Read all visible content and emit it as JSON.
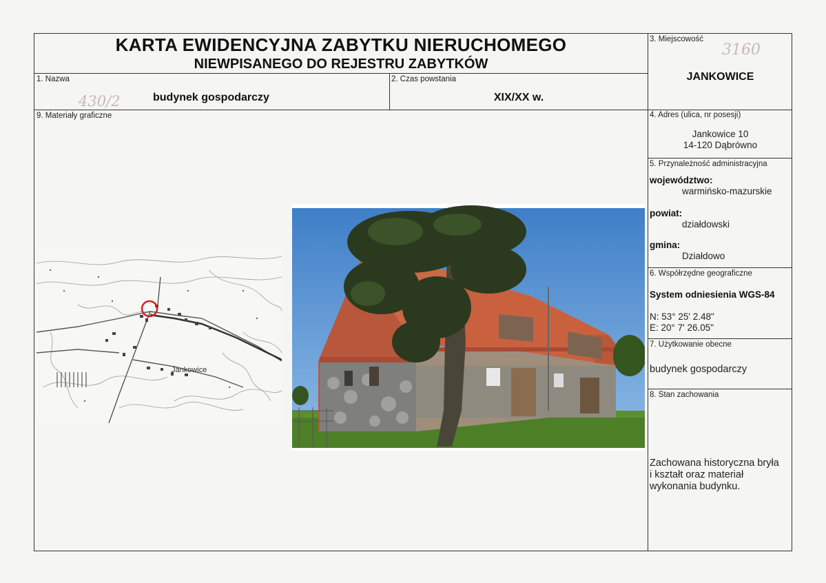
{
  "header": {
    "title": "KARTA EWIDENCYJNA ZABYTKU NIERUCHOMEGO",
    "subtitle": "NIEWPISANEGO DO REJESTRU ZABYTKÓW"
  },
  "fields": {
    "name_label": "1. Nazwa",
    "name_value": "budynek gospodarczy",
    "name_handwritten": "430/2",
    "date_label": "2. Czas powstania",
    "date_value": "XIX/XX w.",
    "graphics_label": "9. Materiały graficzne",
    "locality_label": "3. Miejscowość",
    "locality_handwritten": "3160",
    "locality_value": "JANKOWICE",
    "address_label": "4. Adres (ulica, nr posesji)",
    "address_line1": "Jankowice 10",
    "address_line2": "14-120 Dąbrówno",
    "admin_label": "5. Przynależność administracyjna",
    "voivodeship_label": "województwo:",
    "voivodeship_value": "warmińsko-mazurskie",
    "county_label": "powiat:",
    "county_value": "działdowski",
    "commune_label": "gmina:",
    "commune_value": "Działdowo",
    "coords_label": "6. Współrzędne geograficzne",
    "coords_system": "System odniesienia WGS-84",
    "coords_n": "N: 53° 25' 2.48\"",
    "coords_e": "E: 20° 7' 26.05\"",
    "use_label": "7. Użytkowanie obecne",
    "use_value": "budynek gospodarczy",
    "condition_label": "8. Stan zachowania",
    "condition_line1": "Zachowana historyczna bryła",
    "condition_line2": "i kształt oraz materiał",
    "condition_line3": "wykonania budynku."
  },
  "map": {
    "place_label": "Jankowice"
  }
}
